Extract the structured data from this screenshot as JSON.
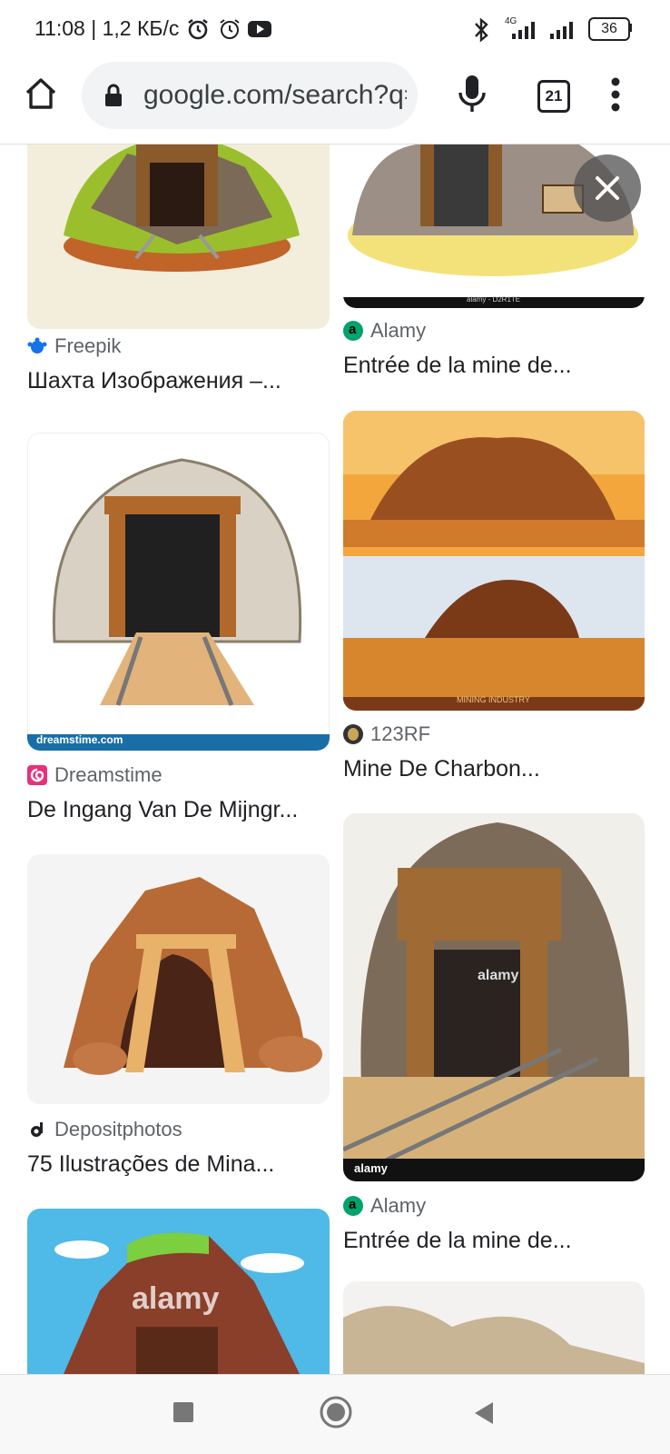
{
  "status_bar": {
    "time": "11:08 | 1,2 КБ/с",
    "network": "4G",
    "battery": "36"
  },
  "toolbar": {
    "url": "google.com/search?q=",
    "tab_count": "21"
  },
  "results": [
    {
      "source": "Freepik",
      "title": "Шахта Изображения –..."
    },
    {
      "source": "Alamy",
      "title": "Entrée de la mine de..."
    },
    {
      "source": "Dreamstime",
      "title": "De Ingang Van De Mijngr..."
    },
    {
      "source": "123RF",
      "title": "Mine De Charbon..."
    },
    {
      "source": "Depositphotos",
      "title": "75 Ilustrações de Mina..."
    },
    {
      "source": "Alamy",
      "title": "Entrée de la mine de..."
    }
  ],
  "watermarks": {
    "dreamstime": "dreamstime.com",
    "alamy": "alamy",
    "alamy_small": "alamy - D2R1TE",
    "mining": "MINING INDUSTRY"
  },
  "colors": {
    "accent_alamy": "#00a36c",
    "accent_dreamstime": "#e8317a",
    "accent_freepik": "#1273eb"
  }
}
